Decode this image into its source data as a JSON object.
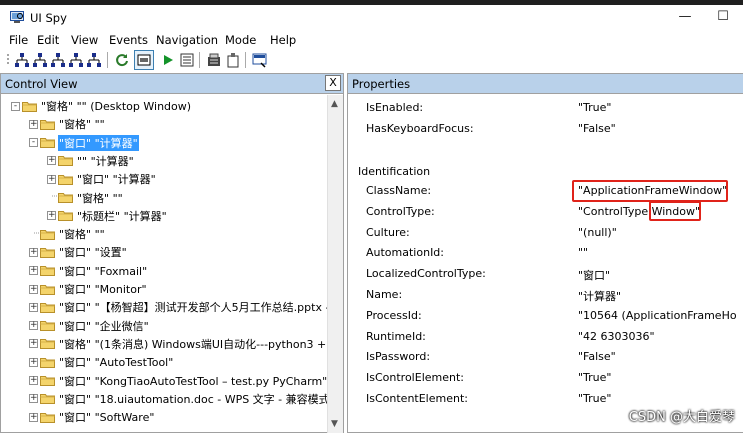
{
  "window": {
    "title": "UI Spy",
    "minimize": "—",
    "maximize": "☐"
  },
  "menu": [
    {
      "label": "File"
    },
    {
      "label": "Edit"
    },
    {
      "label": "View"
    },
    {
      "label": "Events"
    },
    {
      "label": "Navigation"
    },
    {
      "label": "Mode"
    },
    {
      "label": "Help"
    }
  ],
  "toolbar_icons": [
    "hierarchy-icon",
    "hierarchy-icon",
    "hierarchy-icon",
    "hierarchy-icon",
    "hierarchy-icon",
    "refresh-icon",
    "highlight-icon",
    "play-icon",
    "properties-icon",
    "calculator-icon",
    "clipboard-icon",
    "find-icon"
  ],
  "control_view": {
    "title": "Control View",
    "close": "X",
    "tree": [
      {
        "indent": 0,
        "exp": "-",
        "text": "\"窗格\" \"\" (Desktop Window)"
      },
      {
        "indent": 1,
        "exp": "+",
        "text": "\"窗格\" \"\""
      },
      {
        "indent": 1,
        "exp": "-",
        "text": "\"窗口\" \"计算器\"",
        "selected": true
      },
      {
        "indent": 2,
        "exp": "+",
        "text": "\"\" \"计算器\""
      },
      {
        "indent": 2,
        "exp": "+",
        "text": "\"窗口\" \"计算器\""
      },
      {
        "indent": 2,
        "exp": "",
        "text": "\"窗格\" \"\""
      },
      {
        "indent": 2,
        "exp": "+",
        "text": "\"标题栏\" \"计算器\""
      },
      {
        "indent": 1,
        "exp": "",
        "text": "\"窗格\" \"\""
      },
      {
        "indent": 1,
        "exp": "+",
        "text": "\"窗口\" \"设置\""
      },
      {
        "indent": 1,
        "exp": "+",
        "text": "\"窗口\" \"Foxmail\""
      },
      {
        "indent": 1,
        "exp": "+",
        "text": "\"窗口\" \"Monitor\""
      },
      {
        "indent": 1,
        "exp": "+",
        "text": "\"窗口\" \"【杨智超】测试开发部个人5月工作总结.pptx -"
      },
      {
        "indent": 1,
        "exp": "+",
        "text": "\"窗口\" \"企业微信\""
      },
      {
        "indent": 1,
        "exp": "+",
        "text": "\"窗格\" \"(1条消息) Windows端UI自动化---python3 +"
      },
      {
        "indent": 1,
        "exp": "+",
        "text": "\"窗口\" \"AutoTestTool\""
      },
      {
        "indent": 1,
        "exp": "+",
        "text": "\"窗口\" \"KongTiaoAutoTestTool – test.py PyCharm\""
      },
      {
        "indent": 1,
        "exp": "+",
        "text": "\"窗口\" \"18.uiautomation.doc - WPS 文字 - 兼容模式"
      },
      {
        "indent": 1,
        "exp": "+",
        "text": "\"窗口\" \"SoftWare\""
      }
    ]
  },
  "properties": {
    "title": "Properties",
    "rows_top": [
      {
        "name": "IsEnabled:",
        "value": "\"True\""
      },
      {
        "name": "HasKeyboardFocus:",
        "value": "\"False\""
      }
    ],
    "group": "Identification",
    "rows": [
      {
        "name": "ClassName:",
        "value": "\"ApplicationFrameWindow\""
      },
      {
        "name": "ControlType:",
        "value": "\"ControlType.Window\""
      },
      {
        "name": "Culture:",
        "value": "\"(null)\""
      },
      {
        "name": "AutomationId:",
        "value": "\"\""
      },
      {
        "name": "LocalizedControlType:",
        "value": "\"窗口\""
      },
      {
        "name": "Name:",
        "value": "\"计算器\""
      },
      {
        "name": "ProcessId:",
        "value": "\"10564 (ApplicationFrameHo"
      },
      {
        "name": "RuntimeId:",
        "value": "\"42 6303036\""
      },
      {
        "name": "IsPassword:",
        "value": "\"False\""
      },
      {
        "name": "IsControlElement:",
        "value": "\"True\""
      },
      {
        "name": "IsContentElement:",
        "value": "\"True\""
      }
    ]
  },
  "watermark": "CSDN @大白爱琴"
}
